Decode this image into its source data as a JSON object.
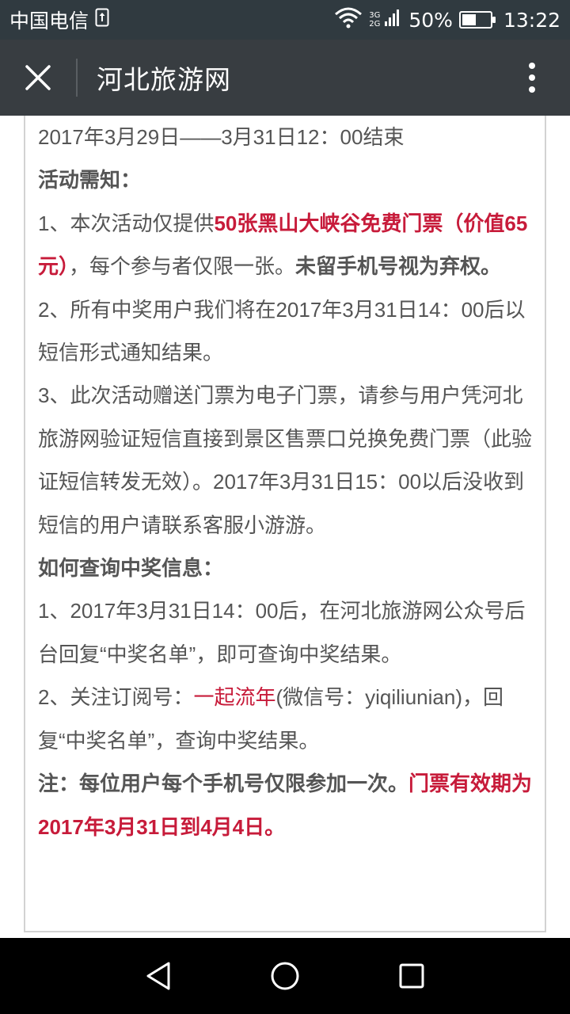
{
  "status_bar": {
    "carrier": "中国电信",
    "network_top": "3G",
    "network_bottom": "2G",
    "battery_percent": "50%",
    "battery_level": 0.5,
    "time": "13:22"
  },
  "app_bar": {
    "title": "河北旅游网"
  },
  "article": {
    "line_date": "2017年3月29日——3月31日12：00结束",
    "notice_heading": "活动需知：",
    "item1_prefix": "1、本次活动仅提供",
    "item1_red": "50张黑山大峡谷免费门票（价值65元）",
    "item1_mid": "，每个参与者仅限一张。",
    "item1_bold": "未留手机号视为弃权。",
    "item2": "2、所有中奖用户我们将在2017年3月31日14：00后以短信形式通知结果。",
    "item3": "3、此次活动赠送门票为电子门票，请参与用户凭河北旅游网验证短信直接到景区售票口兑换免费门票（此验证短信转发无效）。2017年3月31日15：00以后没收到短信的用户请联系客服小游游。",
    "query_heading": "如何查询中奖信息：",
    "query1": "1、2017年3月31日14：00后，在河北旅游网公众号后台回复“中奖名单”，即可查询中奖结果。",
    "query2_prefix": "2、关注订阅号：",
    "query2_red": "一起流年",
    "query2_suffix": "(微信号：yiqiliunian)，回复“中奖名单”，查询中奖结果。",
    "note_bold": "注：每位用户每个手机号仅限参加一次。",
    "note_red": "门票有效期为2017年3月31日到4月4日。"
  },
  "colors": {
    "status_bar_bg": "#303a40",
    "app_bar_bg": "#383d41",
    "highlight_red": "#c71b3a",
    "body_text": "#555555"
  },
  "icons": {
    "close": "close-icon",
    "more": "more-vertical-icon",
    "back": "back-triangle-icon",
    "home": "home-circle-icon",
    "recents": "recents-square-icon"
  }
}
